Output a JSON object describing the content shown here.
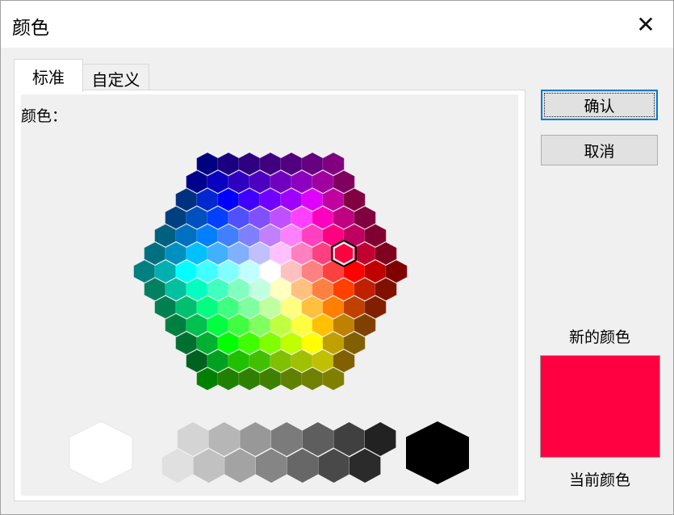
{
  "window": {
    "title": "颜色",
    "close_glyph": "✕"
  },
  "tabs": [
    {
      "label": "标准",
      "active": true
    },
    {
      "label": "自定义",
      "active": false
    }
  ],
  "palette_label": "颜色：",
  "buttons": {
    "ok": "确认",
    "cancel": "取消"
  },
  "preview": {
    "new_label": "新的颜色",
    "current_label": "当前颜色",
    "color": "#ff0040"
  },
  "honeycomb": {
    "selected": {
      "row": 5,
      "col": 9
    },
    "rows": [
      [
        "#000080",
        "#1a0080",
        "#2e0080",
        "#400080",
        "#520080",
        "#670080",
        "#800080"
      ],
      [
        "#00008c",
        "#0c00c0",
        "#2e00c0",
        "#4c00c0",
        "#7000c0",
        "#8c00c0",
        "#a000a0",
        "#800060"
      ],
      [
        "#003080",
        "#0028d0",
        "#0000ff",
        "#4000ff",
        "#7000ff",
        "#a000ff",
        "#e000ff",
        "#c000a0",
        "#800040"
      ],
      [
        "#004080",
        "#0050c0",
        "#0040ff",
        "#5050ff",
        "#8050ff",
        "#c050ff",
        "#ff40ff",
        "#ff00c0",
        "#c00080",
        "#800040"
      ],
      [
        "#006080",
        "#0070c0",
        "#0080ff",
        "#4080ff",
        "#8080ff",
        "#c080ff",
        "#ff80ff",
        "#ff40c0",
        "#ff0080",
        "#c00060",
        "#800030"
      ],
      [
        "#007080",
        "#0090c0",
        "#00c0ff",
        "#40b0ff",
        "#80b0ff",
        "#c0c0ff",
        "#ffc0ff",
        "#ff80c0",
        "#ff4080",
        "#ff0040",
        "#c00030",
        "#800020"
      ],
      [
        "#008080",
        "#00b0b0",
        "#00ffff",
        "#40ffff",
        "#80ffff",
        "#c0ffff",
        "#ffffff",
        "#ffc0c0",
        "#ff8080",
        "#ff4040",
        "#ff0000",
        "#c00000",
        "#800000"
      ],
      [
        "#008060",
        "#00c0a0",
        "#00ffc0",
        "#40ffc0",
        "#80ffc0",
        "#c0ffe0",
        "#ffffc0",
        "#ffc080",
        "#ff8040",
        "#ff4000",
        "#c02000",
        "#801000"
      ],
      [
        "#008050",
        "#00c070",
        "#00ff80",
        "#40ff80",
        "#80ffa0",
        "#c0ffa0",
        "#ffff80",
        "#ffc040",
        "#ff8000",
        "#c04000",
        "#802000"
      ],
      [
        "#008040",
        "#00c050",
        "#00ff40",
        "#40ff40",
        "#80ff60",
        "#c0ff40",
        "#ffff40",
        "#ffc000",
        "#c08000",
        "#804000"
      ],
      [
        "#007030",
        "#00b030",
        "#00ff00",
        "#40ff00",
        "#80ff00",
        "#c0ff00",
        "#ffff00",
        "#c0a000",
        "#806000"
      ],
      [
        "#006020",
        "#00a020",
        "#20c000",
        "#40c000",
        "#80c000",
        "#a0c000",
        "#c0c000",
        "#806000"
      ],
      [
        "#008000",
        "#208000",
        "#308000",
        "#408000",
        "#608000",
        "#708000",
        "#808000"
      ]
    ]
  },
  "grays": {
    "white": "#ffffff",
    "black": "#000000",
    "top": [
      "#d4d4d4",
      "#b6b6b6",
      "#989898",
      "#7b7b7b",
      "#5e5e5e",
      "#404040",
      "#222222"
    ],
    "bottom": [
      "#e0e0e0",
      "#c1c1c1",
      "#a3a3a3",
      "#858585",
      "#676767",
      "#494949",
      "#2b2b2b"
    ]
  }
}
